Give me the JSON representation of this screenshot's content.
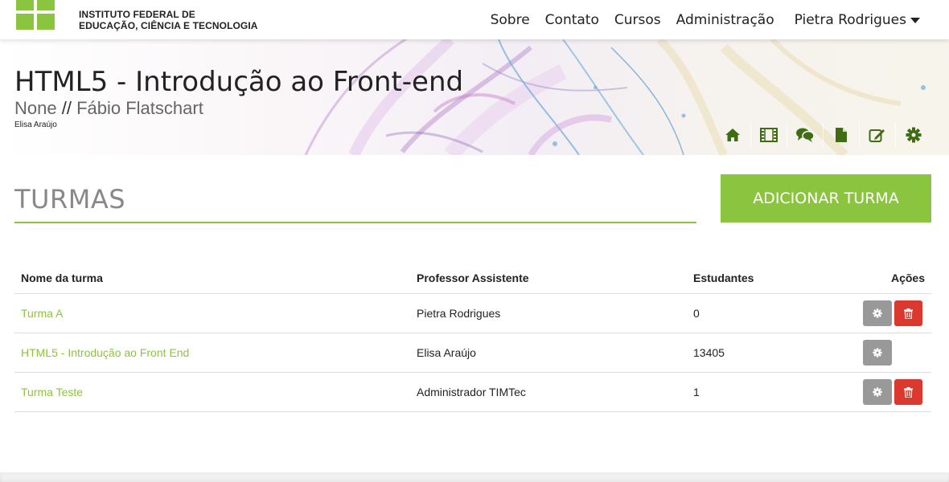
{
  "header": {
    "institution_line1": "INSTITUTO FEDERAL DE",
    "institution_line2": "EDUCAÇÃO, CIÊNCIA E TECNOLOGIA",
    "nav": [
      "Sobre",
      "Contato",
      "Cursos",
      "Administração"
    ],
    "user_name": "Pietra Rodrigues",
    "brand_color": "#8bc53f"
  },
  "course": {
    "title": "HTML5 - Introdução ao Front-end",
    "sub_prefix": "None",
    "sub_separator": "//",
    "professor": "Fábio Flatschart",
    "author": "Elisa Araújo",
    "tools": [
      "home-icon",
      "film-icon",
      "comments-icon",
      "file-icon",
      "edit-icon",
      "gear-icon"
    ]
  },
  "page": {
    "section_title": "TURMAS",
    "add_button": "ADICIONAR TURMA"
  },
  "table": {
    "headers": [
      "Nome da turma",
      "Professor Assistente",
      "Estudantes",
      "Ações"
    ],
    "rows": [
      {
        "name": "Turma A",
        "assistant": "Pietra Rodrigues",
        "students": "0",
        "deletable": true
      },
      {
        "name": "HTML5 - Introdução ao Front End",
        "assistant": "Elisa Araújo",
        "students": "13405",
        "deletable": false
      },
      {
        "name": "Turma Teste",
        "assistant": "Administrador TIMTec",
        "students": "1",
        "deletable": true
      }
    ],
    "delete_color": "#d9392e",
    "settings_color": "#999999"
  }
}
